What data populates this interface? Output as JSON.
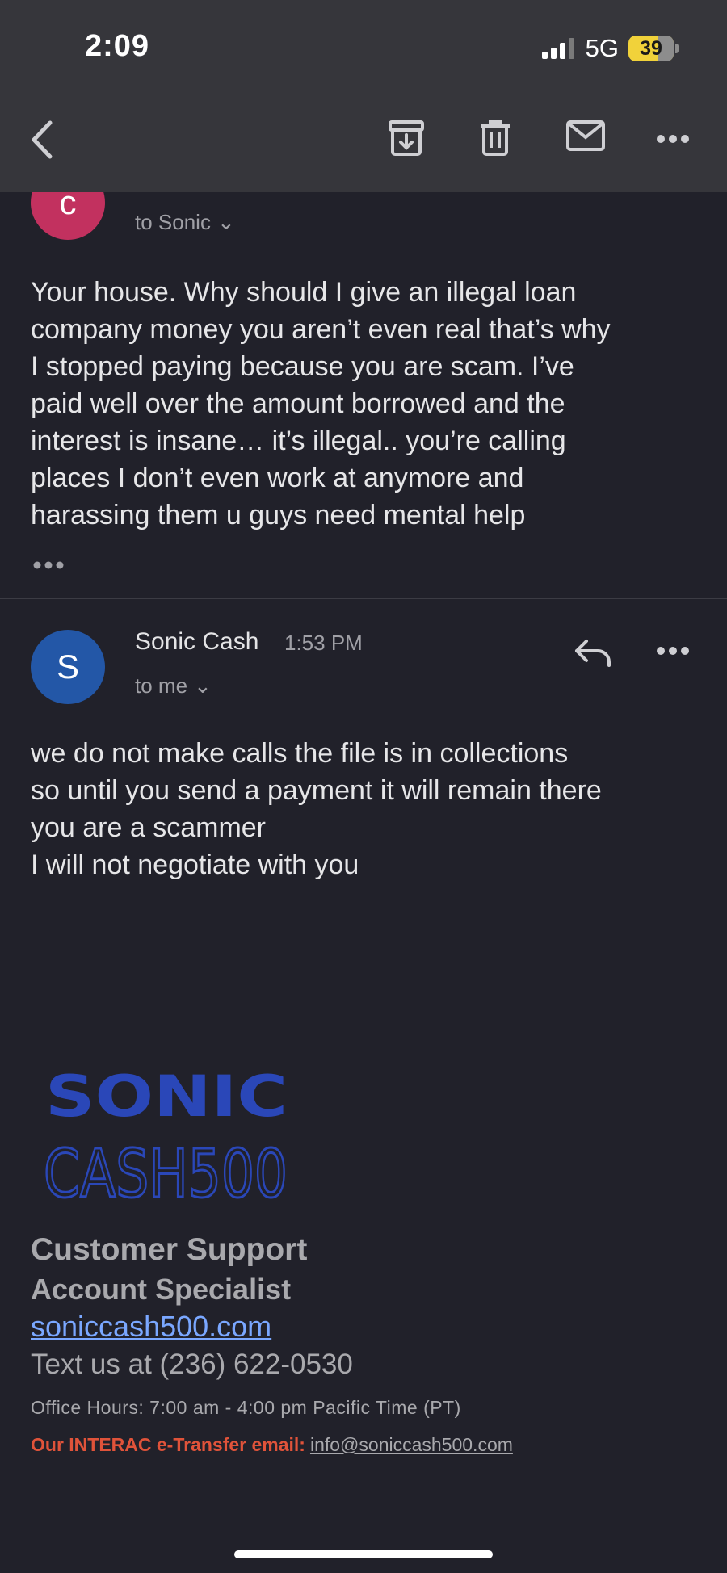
{
  "status_bar": {
    "time": "2:09",
    "network": "5G",
    "battery": "39"
  },
  "toolbar": {
    "back_icon": "chevron-left-icon",
    "archive_icon": "archive-icon",
    "trash_icon": "trash-icon",
    "mail_icon": "mail-icon",
    "more_icon": "more-horizontal-icon"
  },
  "messages": [
    {
      "avatar_letter": "c",
      "avatar_color": "#c2315f",
      "recipient": "to Sonic",
      "body": "Your house. Why should I give an illegal loan\ncompany money you aren’t even real that’s why\nI stopped paying because you are scam. I’ve\npaid well over the amount borrowed and the\ninterest is insane… it’s illegal.. you’re calling\nplaces I don’t even work at anymore and\nharassing them u guys need mental help"
    },
    {
      "avatar_letter": "S",
      "avatar_color": "#2357a7",
      "sender": "Sonic Cash",
      "time": "1:53 PM",
      "recipient": "to me",
      "body": "we do not make calls the file is in collections\nso until you send a payment it will remain there\nyou are a scammer\nI will not negotiate with you"
    }
  ],
  "signature": {
    "logo_line1": "SONIC",
    "logo_line2": "CASH500",
    "title1": "Customer Support",
    "title2": "Account Specialist",
    "website": "soniccash500.com",
    "phone": "Text us at (236) 622-0530",
    "hours": "Office Hours: 7:00 am - 4:00 pm Pacific Time (PT)",
    "interac_label": "Our INTERAC e-Transfer email:",
    "interac_email": "info@soniccash500.com"
  },
  "colors": {
    "background": "#21212a",
    "toolbar": "#36363b",
    "link": "#7aa7ff",
    "interac": "#e0533a",
    "logo_blue": "#2a47b8"
  }
}
